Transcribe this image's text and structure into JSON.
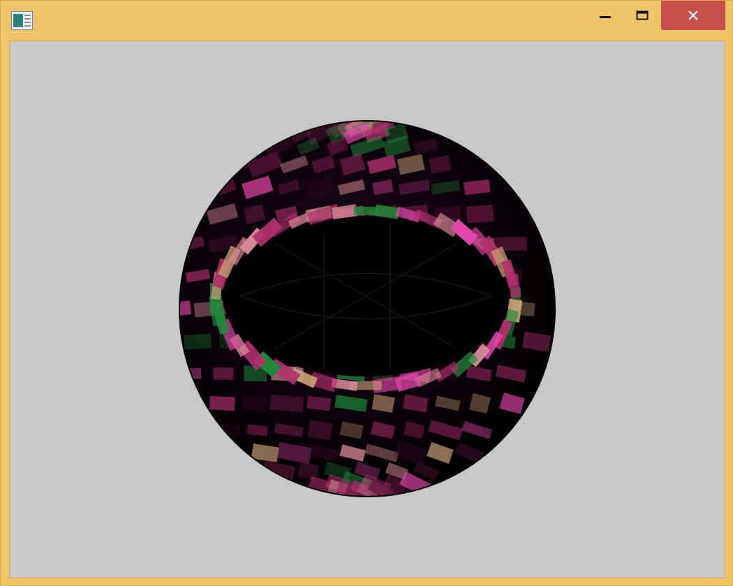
{
  "window": {
    "title": "",
    "app_icon": "application-window-icon",
    "controls": {
      "minimize_icon": "minimize-icon",
      "maximize_icon": "maximize-icon",
      "close_icon": "close-icon"
    },
    "colors": {
      "frame": "#f0c468",
      "close_button": "#c9504a",
      "viewport_background": "#c8c8c8"
    }
  },
  "scene": {
    "object": "tiled-sphere",
    "colors": {
      "sphere_body": "#050005",
      "tile_magenta": "#b0306c",
      "tile_pink": "#e046a8",
      "tile_rose": "#d88a9a",
      "tile_green": "#1f8a3a",
      "tile_tan": "#c8a077"
    }
  }
}
